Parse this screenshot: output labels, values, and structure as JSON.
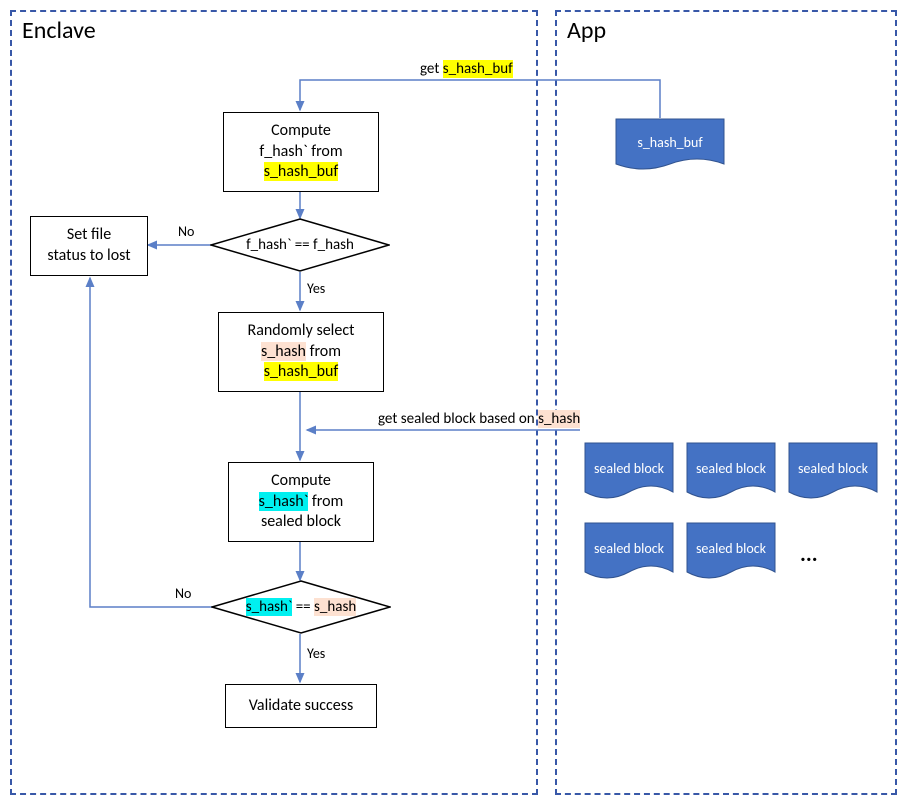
{
  "sections": {
    "enclave_title": "Enclave",
    "app_title": "App"
  },
  "nodes": {
    "compute_fhash_l1": "Compute",
    "compute_fhash_l2a": "f_hash` from",
    "compute_fhash_l2b": "s_hash_buf",
    "decision1_a": "f_hash`",
    "decision1_b": " == f_hash",
    "random_select_l1": "Randomly select",
    "random_select_l2": "s_hash",
    "random_select_l2b": " from",
    "random_select_l3": "s_hash_buf",
    "compute_shash_l1": "Compute",
    "compute_shash_l2": "s_hash`",
    "compute_shash_l2b": " from",
    "compute_shash_l3": "sealed block",
    "decision2_a": "s_hash`",
    "decision2_b": " == ",
    "decision2_c": "s_hash",
    "validate_success": "Validate success",
    "set_lost_l1": "Set file",
    "set_lost_l2": "status to lost",
    "s_hash_buf_doc": "s_hash_buf",
    "sealed_block": "sealed block"
  },
  "edges": {
    "get_shashbuf_a": "get ",
    "get_shashbuf_b": "s_hash_buf",
    "get_sealed_a": "get sealed block based on ",
    "get_sealed_b": "s_hash",
    "yes": "Yes",
    "no": "No"
  },
  "misc": {
    "ellipsis": "..."
  }
}
